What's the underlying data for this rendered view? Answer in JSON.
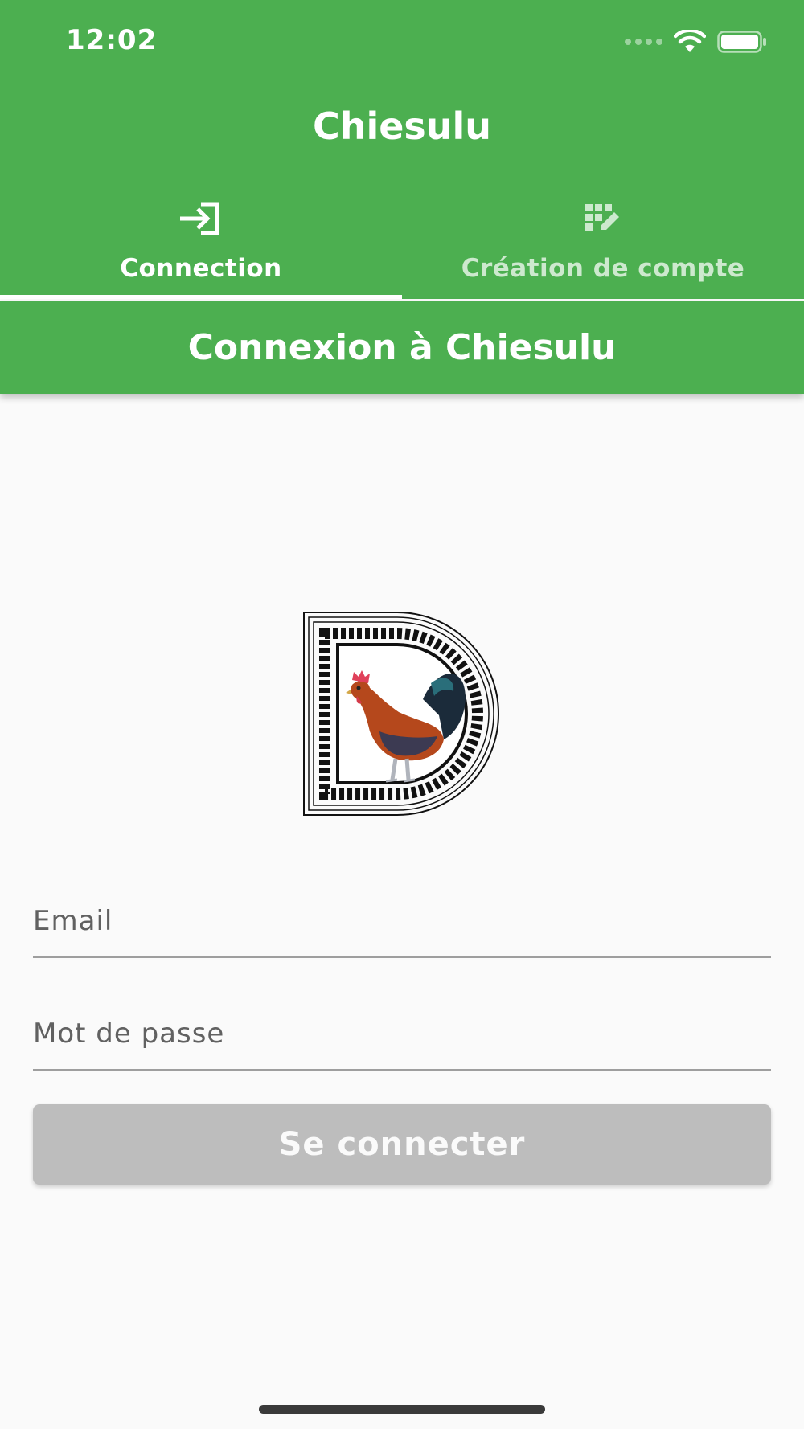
{
  "status_bar": {
    "time": "12:02",
    "signal_icon": "cellular-signal-icon",
    "wifi_icon": "wifi-icon",
    "battery_icon": "battery-icon"
  },
  "app_bar": {
    "title": "Chiesulu",
    "background_color": "#4caf50"
  },
  "tabs": [
    {
      "label": "Connection",
      "icon": "login-arrow-icon",
      "active": true
    },
    {
      "label": "Création de compte",
      "icon": "grid-edit-icon",
      "active": false
    }
  ],
  "subheader": {
    "title": "Connexion à Chiesulu"
  },
  "logo": {
    "description_icon": "rooster-letter-d-logo"
  },
  "form": {
    "email_placeholder": "Email",
    "password_placeholder": "Mot de passe",
    "submit_label": "Se connecter",
    "submit_color": "#bdbdbd"
  }
}
